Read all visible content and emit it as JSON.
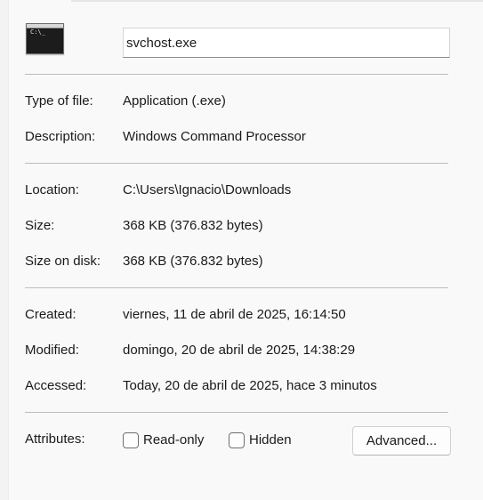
{
  "file": {
    "icon": "command-prompt-icon",
    "icon_text": "C:\\_",
    "name": "svchost.exe"
  },
  "type_section": {
    "type_label": "Type of file:",
    "type_value": "Application (.exe)",
    "description_label": "Description:",
    "description_value": "Windows Command Processor"
  },
  "location_section": {
    "location_label": "Location:",
    "location_value": "C:\\Users\\Ignacio\\Downloads",
    "size_label": "Size:",
    "size_value": "368 KB (376.832 bytes)",
    "size_on_disk_label": "Size on disk:",
    "size_on_disk_value": "368 KB (376.832 bytes)"
  },
  "dates_section": {
    "created_label": "Created:",
    "created_value": "viernes, 11 de abril de 2025, 16:14:50",
    "modified_label": "Modified:",
    "modified_value": "domingo, 20 de abril de 2025, 14:38:29",
    "accessed_label": "Accessed:",
    "accessed_value": "Today, 20 de abril de 2025, hace 3 minutos"
  },
  "attributes": {
    "label": "Attributes:",
    "read_only_label": "Read-only",
    "read_only_checked": false,
    "hidden_label": "Hidden",
    "hidden_checked": false,
    "advanced_button_label": "Advanced..."
  }
}
